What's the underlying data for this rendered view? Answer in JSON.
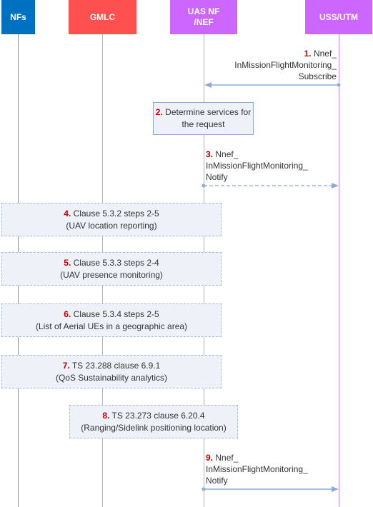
{
  "diagram": {
    "type": "sequence",
    "colors": {
      "nfs": "#0070c0",
      "gmlc": "#ff5050",
      "nef": "#cc66ff",
      "utm": "#cc66ff",
      "arrow": "#8eaadb",
      "step_number": "#c00000",
      "box_fill": "#eef2f8"
    },
    "participants": [
      {
        "id": "nfs",
        "label": "NFs"
      },
      {
        "id": "gmlc",
        "label": "GMLC"
      },
      {
        "id": "nef",
        "label": "UAS NF\n/NEF"
      },
      {
        "id": "utm",
        "label": "USS/UTM"
      }
    ],
    "steps": [
      {
        "num": "1.",
        "text_lines": [
          "Nnef_",
          "InMissionFlightMonitoring_",
          "Subscribe"
        ],
        "from": "utm",
        "to": "nef",
        "style": "solid"
      },
      {
        "num": "2.",
        "text_lines": [
          "Determine services for",
          "the request"
        ],
        "type": "process",
        "at": "nef"
      },
      {
        "num": "3.",
        "text_lines": [
          "Nnef_",
          "InMissionFlightMonitoring_",
          "Notify"
        ],
        "from": "nef",
        "to": "utm",
        "style": "dashed"
      },
      {
        "num": "4.",
        "text_lines": [
          "Clause 5.3.2 steps 2-5",
          "(UAV location reporting)"
        ],
        "type": "group",
        "span": [
          "nfs",
          "nef"
        ]
      },
      {
        "num": "5.",
        "text_lines": [
          "Clause 5.3.3 steps 2-4",
          "(UAV presence monitoring)"
        ],
        "type": "group",
        "span": [
          "nfs",
          "nef"
        ]
      },
      {
        "num": "6.",
        "text_lines": [
          "Clause 5.3.4 steps 2-5",
          "(List of Aerial UEs in a geographic area)"
        ],
        "type": "group",
        "span": [
          "nfs",
          "nef"
        ]
      },
      {
        "num": "7.",
        "text_lines": [
          "TS 23.288 clause 6.9.1",
          "(QoS Sustainability analytics)"
        ],
        "type": "group",
        "span": [
          "nfs",
          "nef"
        ]
      },
      {
        "num": "8.",
        "text_lines": [
          "TS 23.273 clause 6.20.4",
          "(Ranging/Sidelink positioning location)"
        ],
        "type": "group",
        "span": [
          "gmlc",
          "nef"
        ]
      },
      {
        "num": "9.",
        "text_lines": [
          "Nnef_",
          "InMissionFlightMonitoring_",
          "Notify"
        ],
        "from": "nef",
        "to": "utm",
        "style": "solid"
      }
    ]
  }
}
